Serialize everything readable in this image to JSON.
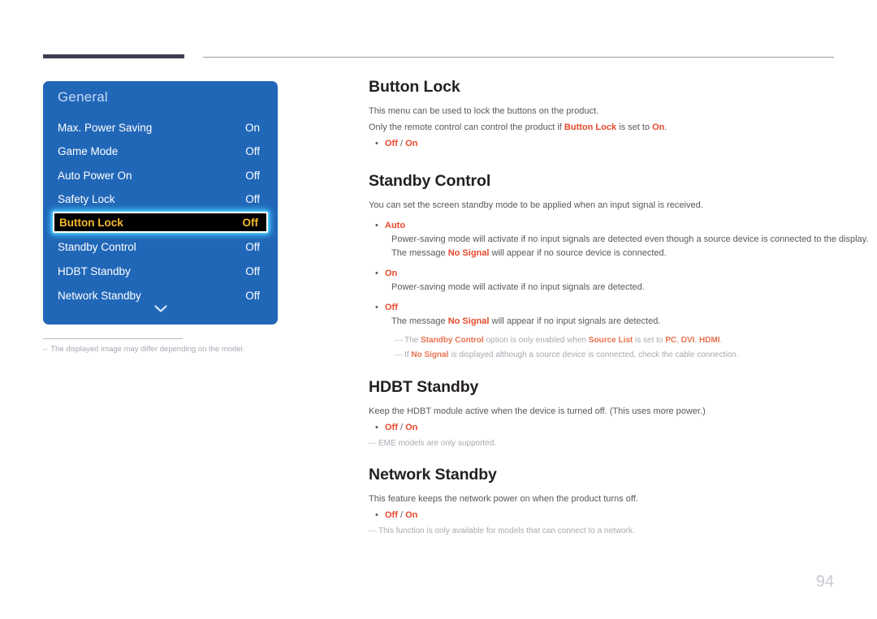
{
  "page": {
    "number": "94"
  },
  "osd": {
    "title": "General",
    "chevron_icon": "chevron-down-icon",
    "rows": [
      {
        "label": "Max. Power Saving",
        "value": "On"
      },
      {
        "label": "Game Mode",
        "value": "Off"
      },
      {
        "label": "Auto Power On",
        "value": "Off"
      },
      {
        "label": "Safety Lock",
        "value": "Off"
      },
      {
        "label": "Button Lock",
        "value": "Off",
        "selected": true
      },
      {
        "label": "Standby Control",
        "value": "Off"
      },
      {
        "label": "HDBT Standby",
        "value": "Off"
      },
      {
        "label": "Network Standby",
        "value": "Off"
      }
    ]
  },
  "left_note": {
    "dash": "–",
    "text": "The displayed image may differ depending on the model."
  },
  "sections": {
    "button_lock": {
      "title": "Button Lock",
      "p1": "This menu can be used to lock the buttons on the product.",
      "p2_a": "Only the remote control can control the product if ",
      "p2_b": "Button Lock",
      "p2_c": " is set to ",
      "p2_d": "On",
      "p2_e": ".",
      "bullet_dot": "•",
      "opt_off": "Off",
      "opt_sep": " / ",
      "opt_on": "On"
    },
    "standby_control": {
      "title": "Standby Control",
      "p1": "You can set the screen standby mode to be applied when an input signal is received.",
      "bullet_dot": "•",
      "opt_auto": "Auto",
      "auto_line1": "Power-saving mode will activate if no input signals are detected even though a source device is connected to the display.",
      "auto_line2_a": "The message ",
      "auto_line2_b": "No Signal",
      "auto_line2_c": " will appear if no source device is connected.",
      "opt_on": "On",
      "on_line1": "Power-saving mode will activate if no input signals are detected.",
      "opt_off": "Off",
      "off_line1_a": "The message ",
      "off_line1_b": "No Signal",
      "off_line1_c": " will appear if no input signals are detected.",
      "note_dash": "—",
      "note1_a": "The ",
      "note1_b": "Standby Control",
      "note1_c": " option is only enabled when ",
      "note1_d": "Source List",
      "note1_e": " is set to ",
      "note1_f": "PC",
      "note1_g": ", ",
      "note1_h": "DVI",
      "note1_i": ", ",
      "note1_j": "HDMI",
      "note1_k": ".",
      "note2_a": "If ",
      "note2_b": "No Signal",
      "note2_c": " is displayed although a source device is connected, check the cable connection."
    },
    "hdbt_standby": {
      "title": "HDBT Standby",
      "p1": "Keep the HDBT module active when the device is turned off. (This uses more power.)",
      "bullet_dot": "•",
      "opt_off": "Off",
      "opt_sep": " / ",
      "opt_on": "On",
      "note_dash": "—",
      "note1": "EME models are only supported."
    },
    "network_standby": {
      "title": "Network Standby",
      "p1": "This feature keeps the network power on when the product turns off.",
      "bullet_dot": "•",
      "opt_off": "Off",
      "opt_sep": " / ",
      "opt_on": "On",
      "note_dash": "—",
      "note1": "This function is only available for models that can connect to a network."
    }
  }
}
